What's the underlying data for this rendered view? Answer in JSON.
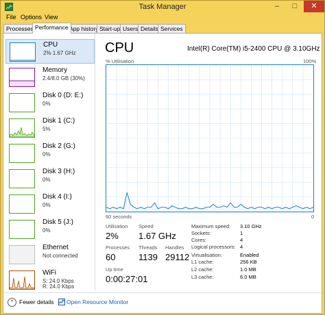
{
  "window": {
    "title": "Task Manager",
    "min": "–",
    "max": "□",
    "close": "✕",
    "app_icon": "task-manager-icon"
  },
  "menu": [
    "File",
    "Options",
    "View"
  ],
  "tabs": [
    "Processes",
    "Performance",
    "App history",
    "Start-up",
    "Users",
    "Details",
    "Services"
  ],
  "active_tab": "Performance",
  "sidebar": [
    {
      "name": "CPU",
      "sub": "2% 1.67 GHz",
      "color": "#1d7fc0",
      "selected": true
    },
    {
      "name": "Memory",
      "sub": "2.4/8.0 GB (30%)",
      "color": "#8b12ae"
    },
    {
      "name": "Disk 0 (D: E:)",
      "sub": "0%",
      "color": "#4da51d"
    },
    {
      "name": "Disk 1 (C:)",
      "sub": "5%",
      "color": "#4da51d"
    },
    {
      "name": "Disk 2 (G:)",
      "sub": "0%",
      "color": "#4da51d"
    },
    {
      "name": "Disk 3 (H:)",
      "sub": "0%",
      "color": "#4da51d"
    },
    {
      "name": "Disk 4 (I:)",
      "sub": "0%",
      "color": "#4da51d"
    },
    {
      "name": "Disk 5 (J:)",
      "sub": "0%",
      "color": "#4da51d"
    },
    {
      "name": "Ethernet",
      "sub": "Not connected",
      "color": "#999999"
    },
    {
      "name": "WiFi",
      "sub": "S: 24.0 Kbps",
      "sub2": "R: 24.0 Kbps",
      "color": "#a74f01"
    }
  ],
  "main": {
    "title": "CPU",
    "model": "Intel(R) Core(TM) i5-2400 CPU @ 3.10GHz",
    "graph_top_left": "% Utilisation",
    "graph_top_right": "100%",
    "graph_bottom_left": "60 seconds",
    "graph_bottom_right": "0",
    "stats": {
      "utilisation_label": "Utilisation",
      "utilisation": "2%",
      "speed_label": "Speed",
      "speed": "1.67 GHz",
      "processes_label": "Processes",
      "processes": "60",
      "threads_label": "Threads",
      "threads": "1139",
      "handles_label": "Handles",
      "handles": "29112",
      "uptime_label": "Up time",
      "uptime": "0:00:27:01"
    },
    "specs": [
      {
        "key": "Maximum speed:",
        "val": "3.10 GHz"
      },
      {
        "key": "Sockets:",
        "val": "1"
      },
      {
        "key": "Cores:",
        "val": "4"
      },
      {
        "key": "Logical processors:",
        "val": "4"
      },
      {
        "key": "Virtualisation:",
        "val": "Enabled"
      },
      {
        "key": "L1 cache:",
        "val": "256 KB"
      },
      {
        "key": "L2 cache:",
        "val": "1.0 MB"
      },
      {
        "key": "L3 cache:",
        "val": "6.0 MB"
      }
    ]
  },
  "bottom": {
    "fewer": "Fewer details",
    "open": "Open Resource Monitor"
  },
  "chart_data": {
    "type": "line",
    "xlabel": "60 seconds",
    "ylabel": "% Utilisation",
    "ylim": [
      0,
      100
    ],
    "xlim": [
      60,
      0
    ],
    "grid": true,
    "series": [
      {
        "values": [
          3,
          2,
          3,
          2,
          3,
          2,
          13,
          5,
          3,
          2,
          3,
          2,
          3,
          3,
          6,
          2,
          3,
          3,
          2,
          4,
          3,
          2,
          2,
          3,
          2,
          2,
          3,
          2,
          2,
          3,
          3,
          5,
          3,
          3,
          4,
          3,
          6,
          3,
          3,
          5,
          3,
          2,
          3,
          2,
          3,
          3,
          2,
          3,
          2,
          3,
          3,
          2,
          3,
          2,
          3,
          4,
          3,
          2,
          3,
          2,
          3
        ]
      }
    ]
  }
}
